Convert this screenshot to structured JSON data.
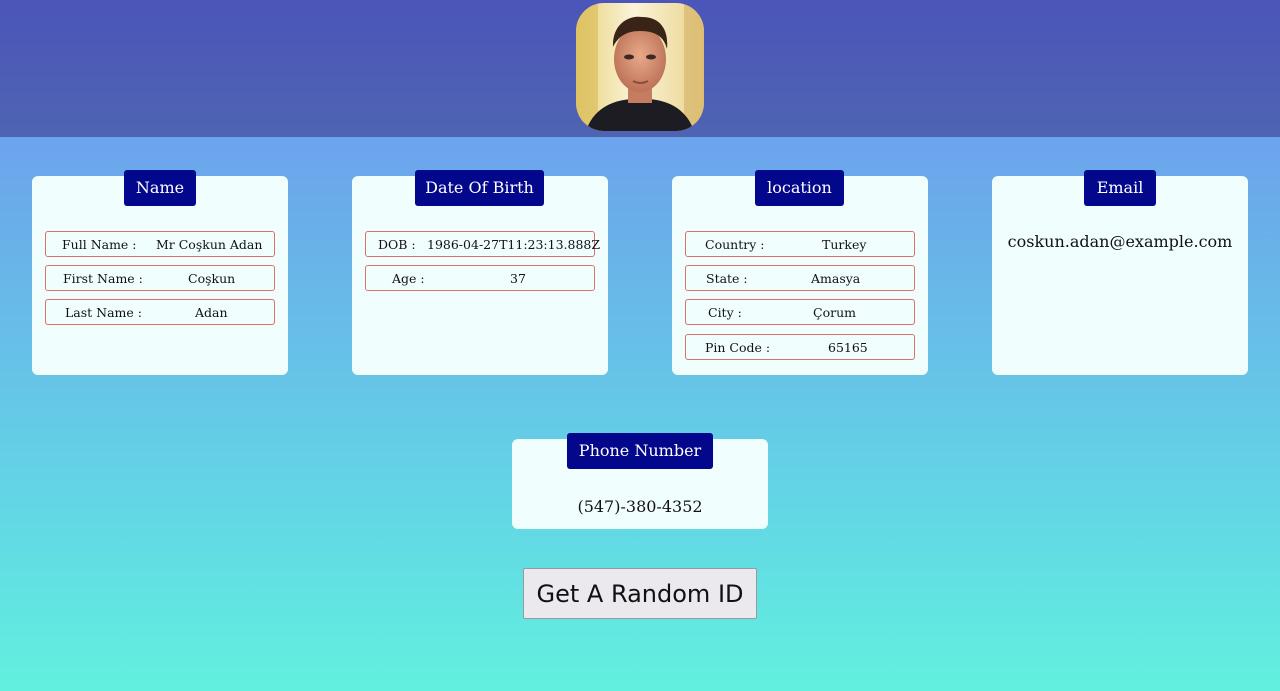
{
  "name_card": {
    "title": "Name",
    "rows": [
      {
        "label": "Full Name :",
        "value": "Mr Coşkun Adan"
      },
      {
        "label": "First Name :",
        "value": "Coşkun"
      },
      {
        "label": "Last Name :",
        "value": "Adan"
      }
    ]
  },
  "dob_card": {
    "title": "Date Of Birth",
    "rows": [
      {
        "label": "DOB :",
        "value": "1986-04-27T11:23:13.888Z"
      },
      {
        "label": "Age :",
        "value": "37"
      }
    ]
  },
  "location_card": {
    "title": "location",
    "rows": [
      {
        "label": "Country :",
        "value": "Turkey"
      },
      {
        "label": "State :",
        "value": "Amasya"
      },
      {
        "label": "City :",
        "value": "Çorum"
      },
      {
        "label": "Pin Code :",
        "value": "65165"
      }
    ]
  },
  "email_card": {
    "title": "Email",
    "value": "coskun.adan@example.com"
  },
  "phone_card": {
    "title": "Phone Number",
    "value": "(547)-380-4352"
  },
  "button": {
    "label": "Get A Random ID"
  },
  "colors": {
    "header": "#4e5cb6",
    "title_badge": "#03078b",
    "card_bg": "#f0fffe",
    "row_border": "#e0706a",
    "gradient_top": "#7192f8",
    "gradient_bottom": "#61f0de"
  }
}
